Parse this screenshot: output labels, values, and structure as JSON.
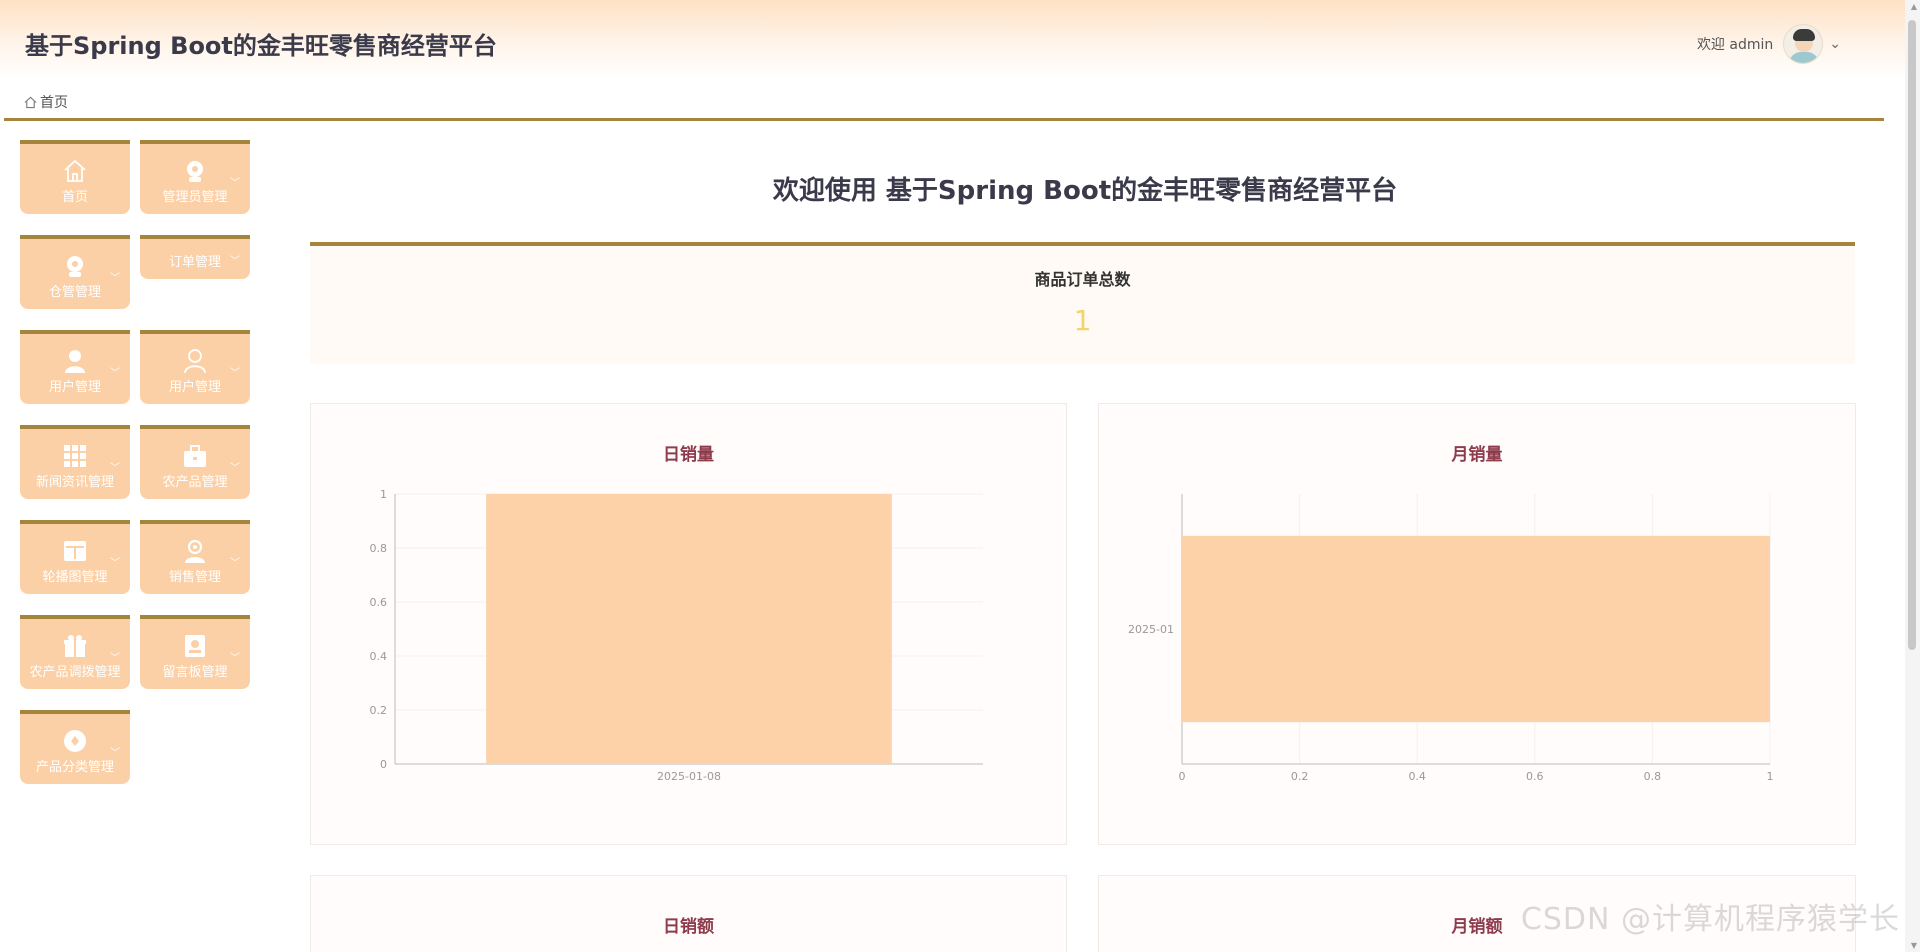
{
  "header": {
    "app_title": "基于Spring Boot的金丰旺零售商经营平台",
    "welcome_text": "欢迎 admin"
  },
  "breadcrumb": {
    "home": "首页"
  },
  "sidebar": {
    "items": [
      {
        "label": "首页",
        "icon": "home-icon",
        "has_submenu": false
      },
      {
        "label": "管理员管理",
        "icon": "admin-icon",
        "has_submenu": true
      },
      {
        "label": "仓管管理",
        "icon": "warehouse-user-icon",
        "has_submenu": true
      },
      {
        "label": "订单管理",
        "icon": "",
        "has_submenu": true
      },
      {
        "label": "用户管理",
        "icon": "user-filled-icon",
        "has_submenu": true
      },
      {
        "label": "用户管理",
        "icon": "user-outline-icon",
        "has_submenu": true
      },
      {
        "label": "新闻资讯管理",
        "icon": "grid-icon",
        "has_submenu": true
      },
      {
        "label": "农产品管理",
        "icon": "briefcase-icon",
        "has_submenu": true
      },
      {
        "label": "轮播图管理",
        "icon": "layout-icon",
        "has_submenu": true
      },
      {
        "label": "销售管理",
        "icon": "person-badge-icon",
        "has_submenu": true
      },
      {
        "label": "农产品调拨管理",
        "icon": "gift-icon",
        "has_submenu": true
      },
      {
        "label": "留言板管理",
        "icon": "message-board-icon",
        "has_submenu": true
      },
      {
        "label": "产品分类管理",
        "icon": "category-icon",
        "has_submenu": true
      }
    ]
  },
  "main": {
    "title": "欢迎使用 基于Spring Boot的金丰旺零售商经营平台",
    "stat": {
      "label": "商品订单总数",
      "value": "1"
    }
  },
  "chart_data": [
    {
      "type": "bar",
      "title": "日销量",
      "orientation": "vertical",
      "categories": [
        "2025-01-08"
      ],
      "values": [
        1
      ],
      "ylim": [
        0,
        1
      ],
      "yticks": [
        "0",
        "0.2",
        "0.4",
        "0.6",
        "0.8",
        "1"
      ],
      "color": "#fdd2a8"
    },
    {
      "type": "bar",
      "title": "月销量",
      "orientation": "horizontal",
      "categories": [
        "2025-01"
      ],
      "values": [
        1
      ],
      "xlim": [
        0,
        1
      ],
      "xticks": [
        "0",
        "0.2",
        "0.4",
        "0.6",
        "0.8",
        "1"
      ],
      "color": "#fdd2a8"
    },
    {
      "type": "bar",
      "title": "日销额"
    },
    {
      "type": "bar",
      "title": "月销额"
    }
  ],
  "watermark": "CSDN @计算机程序猿学长",
  "colors": {
    "accent": "#a5843c",
    "tile": "#fcd0a6",
    "bar": "#fdd2a8",
    "chart_title": "#8e3b4c",
    "stat_value": "#f3d36b"
  }
}
